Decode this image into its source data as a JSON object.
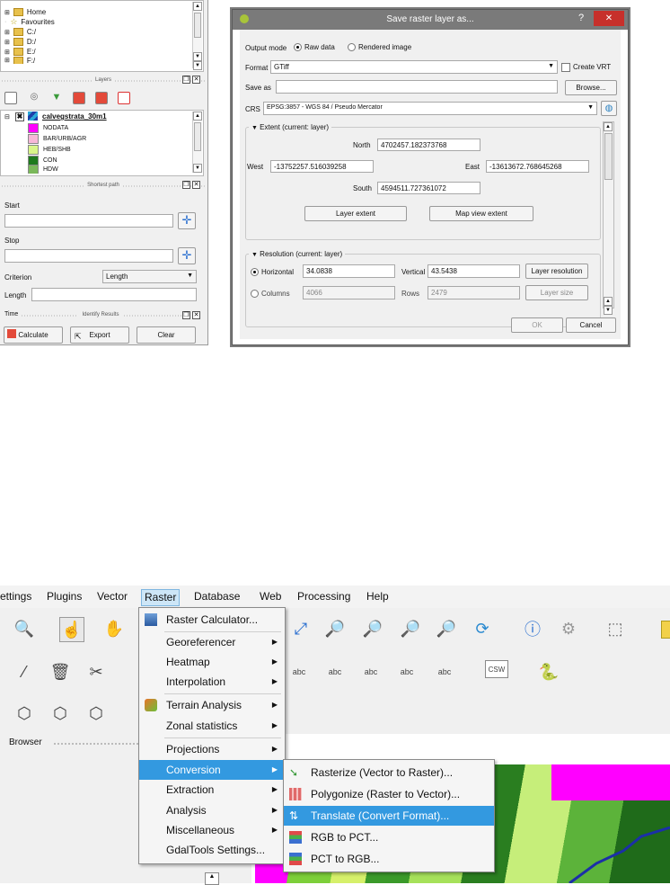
{
  "browser_tree": {
    "items": [
      "Home",
      "Favourites",
      "C:/",
      "D:/",
      "E:/",
      "F:/"
    ]
  },
  "layers_panel": {
    "title": "Layers",
    "layer_name": "calvegstrata_30m1",
    "legend": [
      {
        "label": "NODATA",
        "color": "#ff00ff"
      },
      {
        "label": "BAR/URB/AGR",
        "color": "#f7b7d7"
      },
      {
        "label": "HEB/SHB",
        "color": "#d8f58a"
      },
      {
        "label": "CON",
        "color": "#1e7a1e"
      },
      {
        "label": "HDW",
        "color": "#7ab85a"
      }
    ]
  },
  "shortest_path": {
    "title": "Shortest path",
    "start_label": "Start",
    "stop_label": "Stop",
    "criterion_label": "Criterion",
    "criterion_value": "Length",
    "length_label": "Length",
    "time_label": "Time",
    "identify_title": "Identify Results",
    "calculate": "Calculate",
    "export": "Export",
    "clear": "Clear"
  },
  "dialog": {
    "title": "Save raster layer as...",
    "help": "?",
    "close": "✕",
    "output_mode_label": "Output mode",
    "raw_data": "Raw data",
    "rendered_image": "Rendered image",
    "format_label": "Format",
    "format_value": "GTiff",
    "create_vrt": "Create VRT",
    "save_as_label": "Save as",
    "browse": "Browse...",
    "crs_label": "CRS",
    "crs_value": "EPSG:3857 - WGS 84 / Pseudo Mercator",
    "extent_title": "Extent (current: layer)",
    "north_label": "North",
    "north_value": "4702457.182373768",
    "west_label": "West",
    "west_value": "-13752257.516039258",
    "east_label": "East",
    "east_value": "-13613672.768645268",
    "south_label": "South",
    "south_value": "4594511.727361072",
    "layer_extent": "Layer extent",
    "map_view_extent": "Map view extent",
    "resolution_title": "Resolution (current: layer)",
    "horizontal_label": "Horizontal",
    "horizontal_value": "34.0838",
    "vertical_label": "Vertical",
    "vertical_value": "43.5438",
    "layer_resolution": "Layer resolution",
    "columns_label": "Columns",
    "columns_value": "4066",
    "rows_label": "Rows",
    "rows_value": "2479",
    "layer_size": "Layer size",
    "ok": "OK",
    "cancel": "Cancel"
  },
  "menubar": {
    "items": [
      "ettings",
      "Plugins",
      "Vector",
      "Raster",
      "Database",
      "Web",
      "Processing",
      "Help"
    ]
  },
  "toolbar_labels": {
    "browser": "Browser",
    "csw": "CSW"
  },
  "raster_menu": {
    "items": [
      "Raster Calculator...",
      "Georeferencer",
      "Heatmap",
      "Interpolation",
      "Terrain Analysis",
      "Zonal statistics",
      "Projections",
      "Conversion",
      "Extraction",
      "Analysis",
      "Miscellaneous",
      "GdalTools Settings..."
    ]
  },
  "conversion_menu": {
    "items": [
      "Rasterize (Vector to Raster)...",
      "Polygonize (Raster to Vector)...",
      "Translate (Convert Format)...",
      "RGB to PCT...",
      "PCT to RGB..."
    ]
  },
  "colors": {
    "highlight": "#3399e0",
    "nodata_magenta": "#ff00ff",
    "close_red": "#c7302b"
  }
}
